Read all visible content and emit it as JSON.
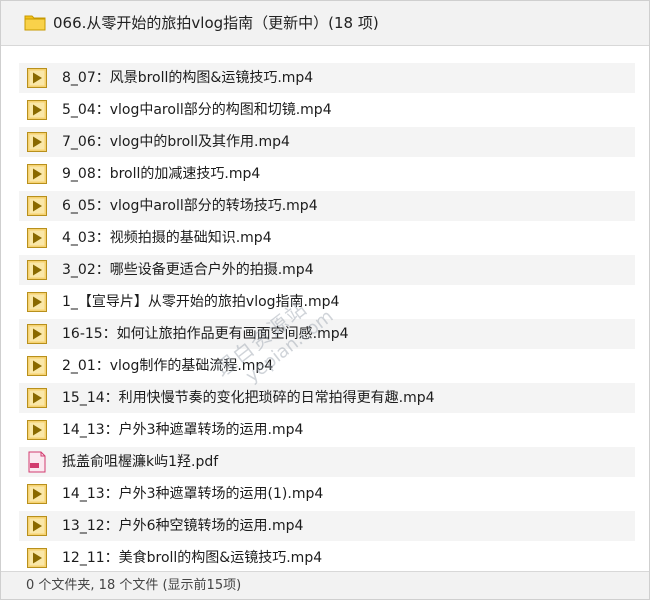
{
  "window": {
    "title": "066.从零开始的旅拍vlog指南（更新中）(18 项)"
  },
  "files": [
    {
      "name": "8_07：风景broll的构图&运镜技巧.mp4",
      "type": "video"
    },
    {
      "name": "5_04：vlog中aroll部分的构图和切镜.mp4",
      "type": "video"
    },
    {
      "name": "7_06：vlog中的broll及其作用.mp4",
      "type": "video"
    },
    {
      "name": "9_08：broll的加减速技巧.mp4",
      "type": "video"
    },
    {
      "name": "6_05：vlog中aroll部分的转场技巧.mp4",
      "type": "video"
    },
    {
      "name": "4_03：视频拍摄的基础知识.mp4",
      "type": "video"
    },
    {
      "name": "3_02：哪些设备更适合户外的拍摄.mp4",
      "type": "video"
    },
    {
      "name": "1_【宣导片】从零开始的旅拍vlog指南.mp4",
      "type": "video"
    },
    {
      "name": "16-15：如何让旅拍作品更有画面空间感.mp4",
      "type": "video"
    },
    {
      "name": "2_01：vlog制作的基础流程.mp4",
      "type": "video"
    },
    {
      "name": "15_14：利用快慢节奏的变化把琐碎的日常拍得更有趣.mp4",
      "type": "video"
    },
    {
      "name": "14_13：户外3种遮罩转场的运用.mp4",
      "type": "video"
    },
    {
      "name": "抵盖俞咀楃濂k屿1羟.pdf",
      "type": "pdf"
    },
    {
      "name": "14_13：户外3种遮罩转场的运用(1).mp4",
      "type": "video"
    },
    {
      "name": "13_12：户外6种空镜转场的运用.mp4",
      "type": "video"
    },
    {
      "name": "12_11：美食broll的构图&运镜技巧.mp4",
      "type": "video"
    }
  ],
  "status": {
    "text": "0 个文件夹, 18 个文件 (显示前15项)"
  },
  "watermark": {
    "line1": "理白资源站",
    "line2": "yepian.com"
  },
  "icons": {
    "folder": "folder-icon",
    "video": "play-file-icon",
    "pdf": "pdf-file-icon"
  },
  "colors": {
    "folder": "#f3c21b",
    "video_bg": "#f6d271",
    "video_play": "#8a6a00",
    "pdf": "#d23c6f"
  }
}
